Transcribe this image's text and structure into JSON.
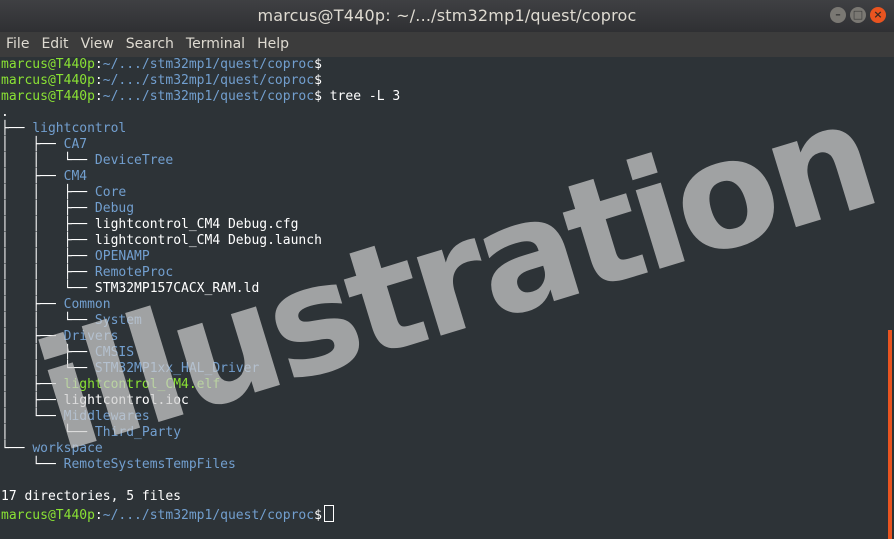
{
  "window": {
    "title": "marcus@T440p: ~/.../stm32mp1/quest/coproc",
    "controls": {
      "minimize": "–",
      "maximize": "□",
      "close": "×"
    }
  },
  "menu": [
    "File",
    "Edit",
    "View",
    "Search",
    "Terminal",
    "Help"
  ],
  "prompt": {
    "user_host": "marcus@T440p",
    "sep": ":",
    "path": "~/.../stm32mp1/quest/coproc",
    "symbol": "$"
  },
  "command": " tree -L 3",
  "tree": [
    {
      "prefix": "",
      "name": ".",
      "kind": "plain"
    },
    {
      "prefix": "├── ",
      "name": "lightcontrol",
      "kind": "dir"
    },
    {
      "prefix": "│   ├── ",
      "name": "CA7",
      "kind": "dir"
    },
    {
      "prefix": "│   │   └── ",
      "name": "DeviceTree",
      "kind": "dir"
    },
    {
      "prefix": "│   ├── ",
      "name": "CM4",
      "kind": "dir"
    },
    {
      "prefix": "│   │   ├── ",
      "name": "Core",
      "kind": "dir"
    },
    {
      "prefix": "│   │   ├── ",
      "name": "Debug",
      "kind": "dir"
    },
    {
      "prefix": "│   │   ├── ",
      "name": "lightcontrol_CM4 Debug.cfg",
      "kind": "file"
    },
    {
      "prefix": "│   │   ├── ",
      "name": "lightcontrol_CM4 Debug.launch",
      "kind": "file"
    },
    {
      "prefix": "│   │   ├── ",
      "name": "OPENAMP",
      "kind": "dir"
    },
    {
      "prefix": "│   │   ├── ",
      "name": "RemoteProc",
      "kind": "dir"
    },
    {
      "prefix": "│   │   └── ",
      "name": "STM32MP157CACX_RAM.ld",
      "kind": "file"
    },
    {
      "prefix": "│   ├── ",
      "name": "Common",
      "kind": "dir"
    },
    {
      "prefix": "│   │   └── ",
      "name": "System",
      "kind": "dir"
    },
    {
      "prefix": "│   ├── ",
      "name": "Drivers",
      "kind": "dir"
    },
    {
      "prefix": "│   │   ├── ",
      "name": "CMSIS",
      "kind": "dir"
    },
    {
      "prefix": "│   │   └── ",
      "name": "STM32MP1xx_HAL_Driver",
      "kind": "dir"
    },
    {
      "prefix": "│   ├── ",
      "name": "lightcontrol_CM4.elf",
      "kind": "exec"
    },
    {
      "prefix": "│   ├── ",
      "name": "lightcontrol.ioc",
      "kind": "file"
    },
    {
      "prefix": "│   └── ",
      "name": "Middlewares",
      "kind": "dir"
    },
    {
      "prefix": "│       └── ",
      "name": "Third_Party",
      "kind": "dir"
    },
    {
      "prefix": "└── ",
      "name": "workspace",
      "kind": "dir"
    },
    {
      "prefix": "    └── ",
      "name": "RemoteSystemsTempFiles",
      "kind": "dir"
    }
  ],
  "summary": "17 directories, 5 files",
  "watermark": "illustration",
  "colors": {
    "prompt_user": "#8ae234",
    "prompt_path": "#729fcf",
    "directory": "#729fcf",
    "executable": "#8ae234",
    "background": "#2d3337",
    "accent": "#e95420"
  }
}
